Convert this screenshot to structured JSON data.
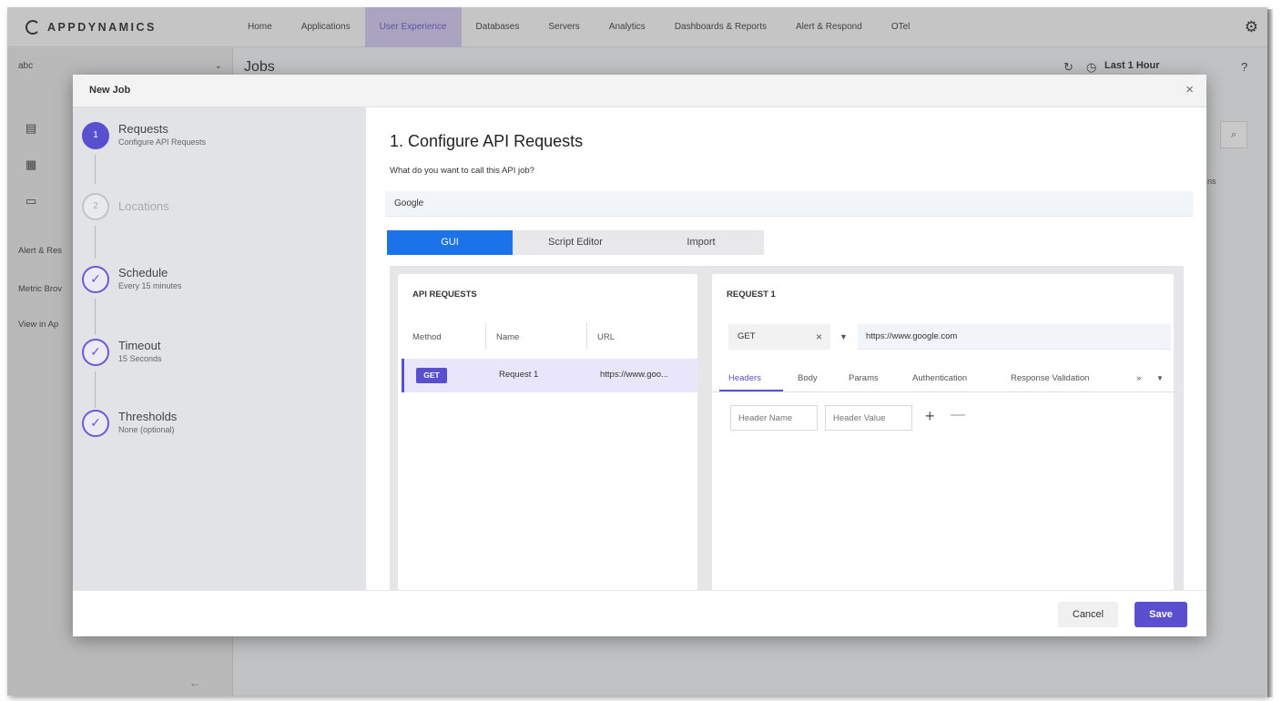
{
  "brand": {
    "name": "APPDYNAMICS"
  },
  "nav": {
    "items": [
      {
        "label": "Home"
      },
      {
        "label": "Applications"
      },
      {
        "label": "User Experience"
      },
      {
        "label": "Databases"
      },
      {
        "label": "Servers"
      },
      {
        "label": "Analytics"
      },
      {
        "label": "Dashboards & Reports"
      },
      {
        "label": "Alert & Respond"
      },
      {
        "label": "OTel"
      }
    ],
    "active": "User Experience",
    "settings_icon": "gear-icon"
  },
  "background": {
    "selector": "abc",
    "page_title": "Jobs",
    "time_range": "Last 1 Hour",
    "sidebar_links": [
      "Alert & Res",
      "Metric Brov",
      "View in Ap"
    ],
    "column_fragment": "ns"
  },
  "modal": {
    "title": "New Job",
    "steps": [
      {
        "number": "1",
        "title": "Requests",
        "subtitle": "Configure API Requests",
        "state": "active"
      },
      {
        "number": "2",
        "title": "Locations",
        "subtitle": "",
        "state": "pending"
      },
      {
        "number": "",
        "title": "Schedule",
        "subtitle": "Every 15 minutes",
        "state": "done"
      },
      {
        "number": "",
        "title": "Timeout",
        "subtitle": "15 Seconds",
        "state": "done"
      },
      {
        "number": "",
        "title": "Thresholds",
        "subtitle": "None (optional)",
        "state": "done"
      }
    ],
    "heading": "1. Configure API Requests",
    "question": "What do you want to call this API job?",
    "job_name": "Google",
    "mode_tabs": [
      {
        "label": "GUI",
        "active": true
      },
      {
        "label": "Script Editor",
        "active": false
      },
      {
        "label": "Import",
        "active": false
      }
    ],
    "api_requests": {
      "heading": "API REQUESTS",
      "columns": [
        "Method",
        "Name",
        "URL"
      ],
      "rows": [
        {
          "method": "GET",
          "name": "Request 1",
          "url": "https://www.goo..."
        }
      ]
    },
    "request": {
      "heading": "REQUEST 1",
      "method": "GET",
      "url": "https://www.google.com",
      "tabs": [
        "Headers",
        "Body",
        "Params",
        "Authentication",
        "Response Validation"
      ],
      "active_tab": "Headers",
      "more_tabs": "»",
      "header_name_placeholder": "Header Name",
      "header_value_placeholder": "Header Value"
    },
    "footer": {
      "cancel": "Cancel",
      "save": "Save"
    }
  },
  "colors": {
    "accent": "#5a4fcf",
    "primary_tab": "#1a73e8",
    "nav_active_bg": "#d5ccf3"
  }
}
